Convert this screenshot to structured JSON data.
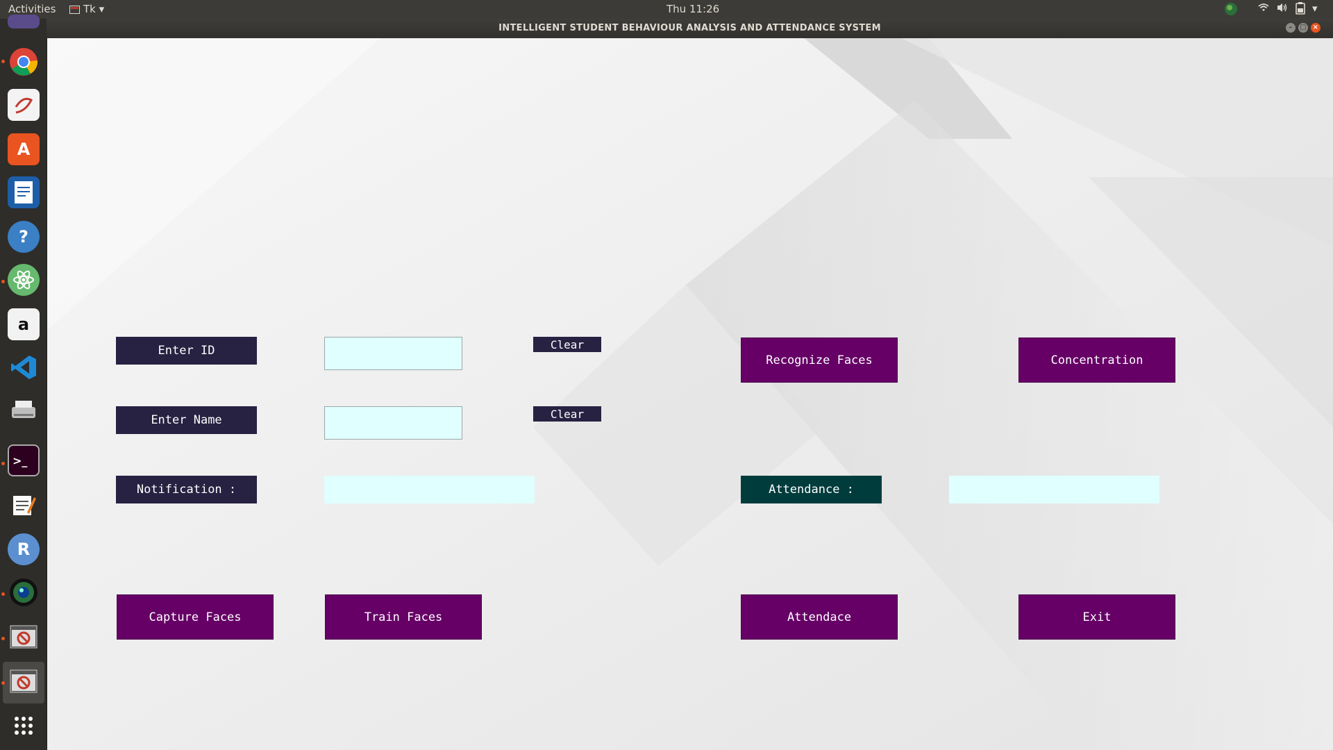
{
  "topbar": {
    "activities": "Activities",
    "app_menu": "Tk",
    "clock": "Thu 11:26"
  },
  "window": {
    "title": "INTELLIGENT STUDENT BEHAVIOUR ANALYSIS AND ATTENDANCE SYSTEM"
  },
  "launcher": {
    "icons": [
      "chrome-icon",
      "document-viewer-icon",
      "software-center-icon",
      "writer-icon",
      "help-icon",
      "atom-icon",
      "amazon-icon",
      "vscode-icon",
      "scanner-icon",
      "terminal-icon",
      "text-editor-icon",
      "r-icon",
      "camera-app-icon",
      "tk-window-icon",
      "tk-window-active-icon",
      "app-grid-icon"
    ]
  },
  "form": {
    "enter_id_label": "Enter ID",
    "enter_name_label": "Enter Name",
    "notification_label": "Notification :",
    "clear_id_button": "Clear",
    "clear_name_button": "Clear",
    "id_value": "",
    "name_value": "",
    "notification_value": ""
  },
  "actions": {
    "recognize_faces": "Recognize Faces",
    "concentration": "Concentration",
    "attendance_label": "Attendance :",
    "attendance_value": "",
    "capture_faces": "Capture Faces",
    "train_faces": "Train Faces",
    "attendace": "Attendace",
    "exit": "Exit"
  },
  "colors": {
    "label_navy": "#272142",
    "button_purple": "#660066",
    "attendance_teal": "#003c3c",
    "entry_bg": "#e0ffff"
  }
}
